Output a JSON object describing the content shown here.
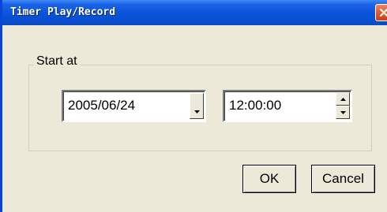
{
  "window": {
    "title": "Timer Play/Record"
  },
  "group": {
    "label": "Start at"
  },
  "date": {
    "value": "2005/06/24"
  },
  "time": {
    "value": "12:00:00"
  },
  "buttons": {
    "ok": "OK",
    "cancel": "Cancel"
  },
  "icons": {
    "close": "close-icon",
    "dropdown": "chevron-down-icon",
    "spin_up": "arrow-up-icon",
    "spin_down": "arrow-down-icon"
  },
  "colors": {
    "titlebar": "#0852d8",
    "close_button": "#e0582a",
    "dialog_background": "#ece9d8"
  }
}
